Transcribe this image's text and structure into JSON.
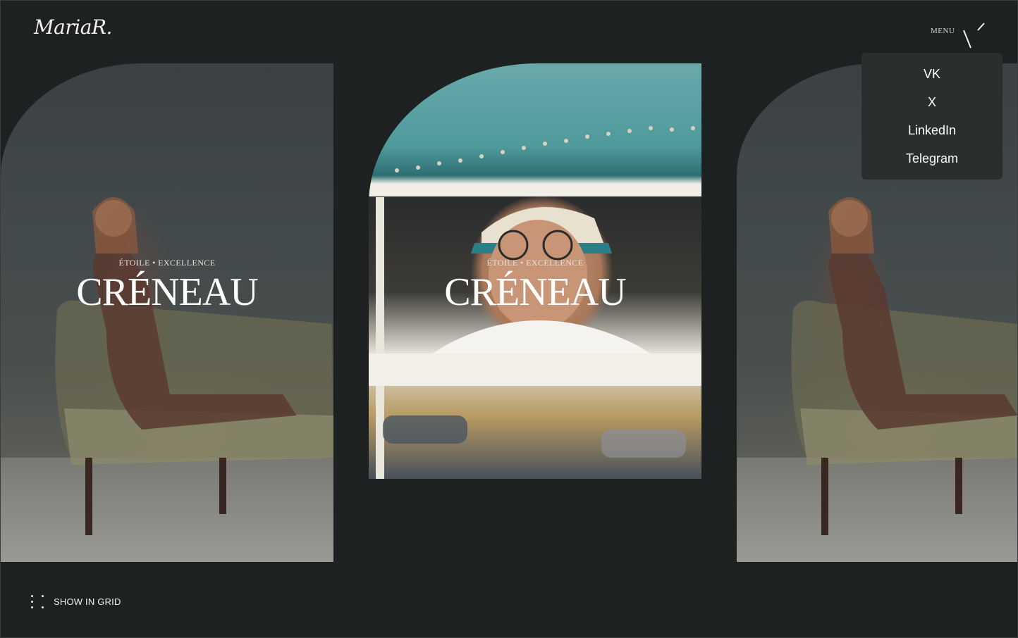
{
  "header": {
    "logo": "MariaR.",
    "menu_label": "MENU"
  },
  "menu": {
    "items": [
      "VK",
      "X",
      "LinkedIn",
      "Telegram"
    ]
  },
  "slides": [
    {
      "kicker": "ÉTOILE • EXCELLENCE",
      "title": "CRÉNEAU"
    },
    {
      "kicker": "ÉTOILE • EXCELLENCE",
      "title": "CRÉNEAU"
    }
  ],
  "footer": {
    "grid_label": "SHOW IN GRID"
  },
  "colors": {
    "background": "#1e2121",
    "dropdown": "#2a2e2e",
    "text": "#f2f0ea"
  }
}
